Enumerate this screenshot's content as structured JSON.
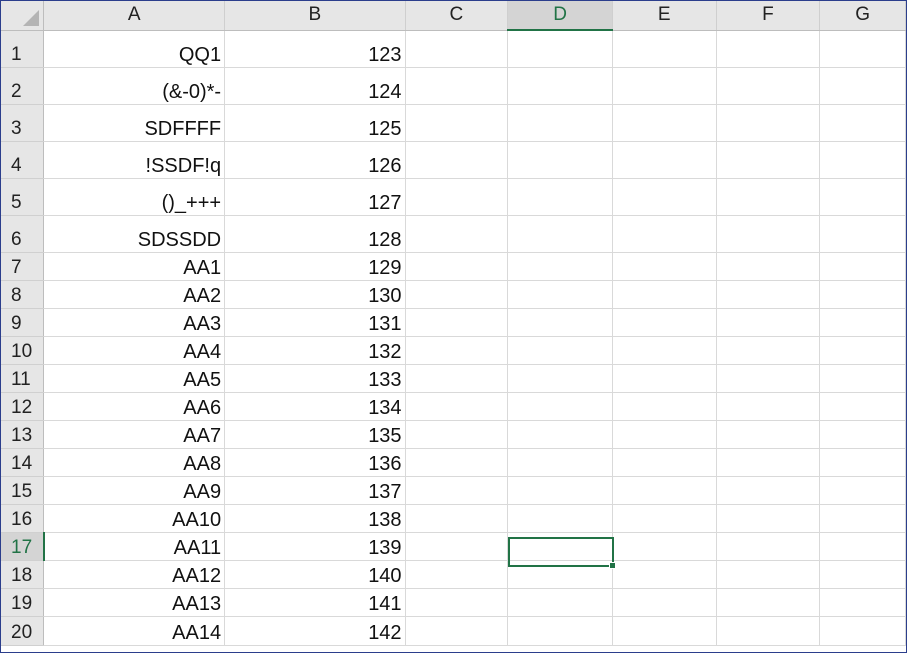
{
  "columns": [
    "A",
    "B",
    "C",
    "D",
    "E",
    "F",
    "G"
  ],
  "active_column": "D",
  "active_row": 17,
  "active_cell": "D17",
  "rows": [
    {
      "n": "1",
      "a": "QQ1",
      "b": "123"
    },
    {
      "n": "2",
      "a": "(&-0)*-",
      "b": "124"
    },
    {
      "n": "3",
      "a": "SDFFFF",
      "b": "125"
    },
    {
      "n": "4",
      "a": "!SSDF!q",
      "b": "126"
    },
    {
      "n": "5",
      "a": "()_+++",
      "b": "127"
    },
    {
      "n": "6",
      "a": "SDSSDD",
      "b": "128"
    },
    {
      "n": "7",
      "a": "AA1",
      "b": "129"
    },
    {
      "n": "8",
      "a": "AA2",
      "b": "130"
    },
    {
      "n": "9",
      "a": "AA3",
      "b": "131"
    },
    {
      "n": "10",
      "a": "AA4",
      "b": "132"
    },
    {
      "n": "11",
      "a": "AA5",
      "b": "133"
    },
    {
      "n": "12",
      "a": "AA6",
      "b": "134"
    },
    {
      "n": "13",
      "a": "AA7",
      "b": "135"
    },
    {
      "n": "14",
      "a": "AA8",
      "b": "136"
    },
    {
      "n": "15",
      "a": "AA9",
      "b": "137"
    },
    {
      "n": "16",
      "a": "AA10",
      "b": "138"
    },
    {
      "n": "17",
      "a": "AA11",
      "b": "139"
    },
    {
      "n": "18",
      "a": "AA12",
      "b": "140"
    },
    {
      "n": "19",
      "a": "AA13",
      "b": "141"
    },
    {
      "n": "20",
      "a": "AA14",
      "b": "142"
    }
  ],
  "colors": {
    "accent": "#217346",
    "header_bg": "#e6e6e6",
    "gridline": "#d9d9d9",
    "window_border": "#2b3e8c"
  },
  "icons": {
    "select_all": "select-all-triangle-icon"
  }
}
